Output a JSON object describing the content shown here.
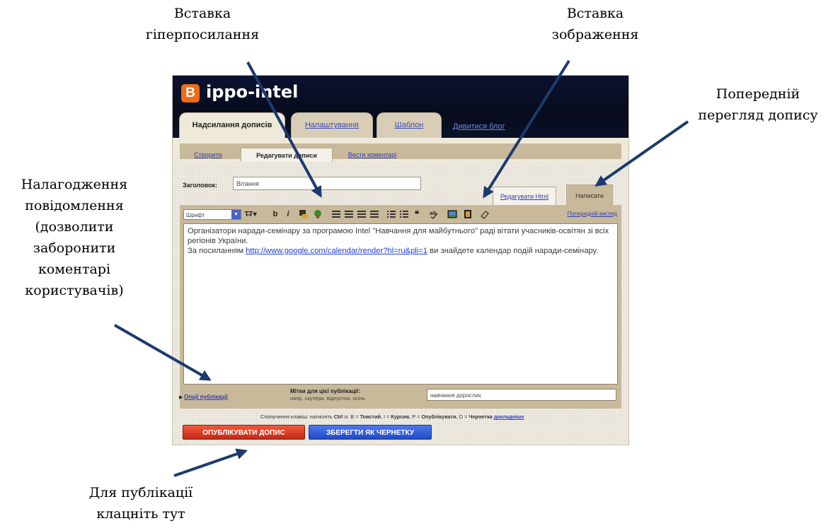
{
  "callouts": {
    "hyperlink": [
      "Вставка",
      "гіперпосилання"
    ],
    "image": [
      "Вставка",
      "зображення"
    ],
    "preview": [
      "Попередній",
      "перегляд допису"
    ],
    "settings": [
      "Налагодження",
      "повідомлення",
      "(дозволити",
      "заборонити",
      "коментарі",
      "користувачів)"
    ],
    "publish": [
      "Для публікації",
      "клацніть тут"
    ]
  },
  "app": {
    "logo_letter": "B",
    "blog_name": "ippo-intel",
    "tabs": [
      "Надсилання дописів",
      "Налаштування",
      "Шаблон"
    ],
    "view_blog": "Дивитися блог",
    "subnav": [
      "Створити",
      "Редагувати дописи",
      "Вести коментарі"
    ],
    "title_label": "Заголовок:",
    "title_value": "Вітання",
    "mode_tabs": {
      "html": "Редагувати Html",
      "compose": "Написати"
    },
    "toolbar": {
      "font": "Шрифт",
      "font_dropdown": "▼",
      "size": "T̶T▾",
      "bold": "b",
      "italic": "i",
      "preview": "Попередній вигляд"
    },
    "body": {
      "line1": "Організатори наради-семінару за програмою Intel \"Навчання для майбутнього\" раді вітати учасників-освітян зі всіх регіонів України.",
      "line2_prefix": "За посиланням ",
      "link": "http://www.google.com/calendar/render?hl=ru&pli=1",
      "line2_suffix": " ви знайдете календар подій наради-семінару."
    },
    "options_arrow": "▶",
    "options": "Опції публікації",
    "labels_title": "Мітки для цієї публікації:",
    "labels_hint": "напр. скутери, відпустка, осінь",
    "labels_value": "навчання дорослих",
    "hint": {
      "a": "Сполучення клавіш: натисніть ",
      "b": "Ctrl",
      "c": " із: В = ",
      "d": "Товстий",
      "e": ", I = ",
      "f": "Курсив",
      "g": ", P = ",
      "h": "Опублікувати",
      "i": ", D = ",
      "j": "Чернетка",
      "k": "докладніше"
    },
    "publish_button": "ОПУБЛІКУВАТИ ДОПИС",
    "save_button": "ЗБЕРЕГТИ ЯК ЧЕРНЕТКУ"
  },
  "colors": {
    "arrow": "#1c3a6e",
    "publish": "#d9381e",
    "save": "#2e5fe0",
    "header": "#0a1128"
  }
}
